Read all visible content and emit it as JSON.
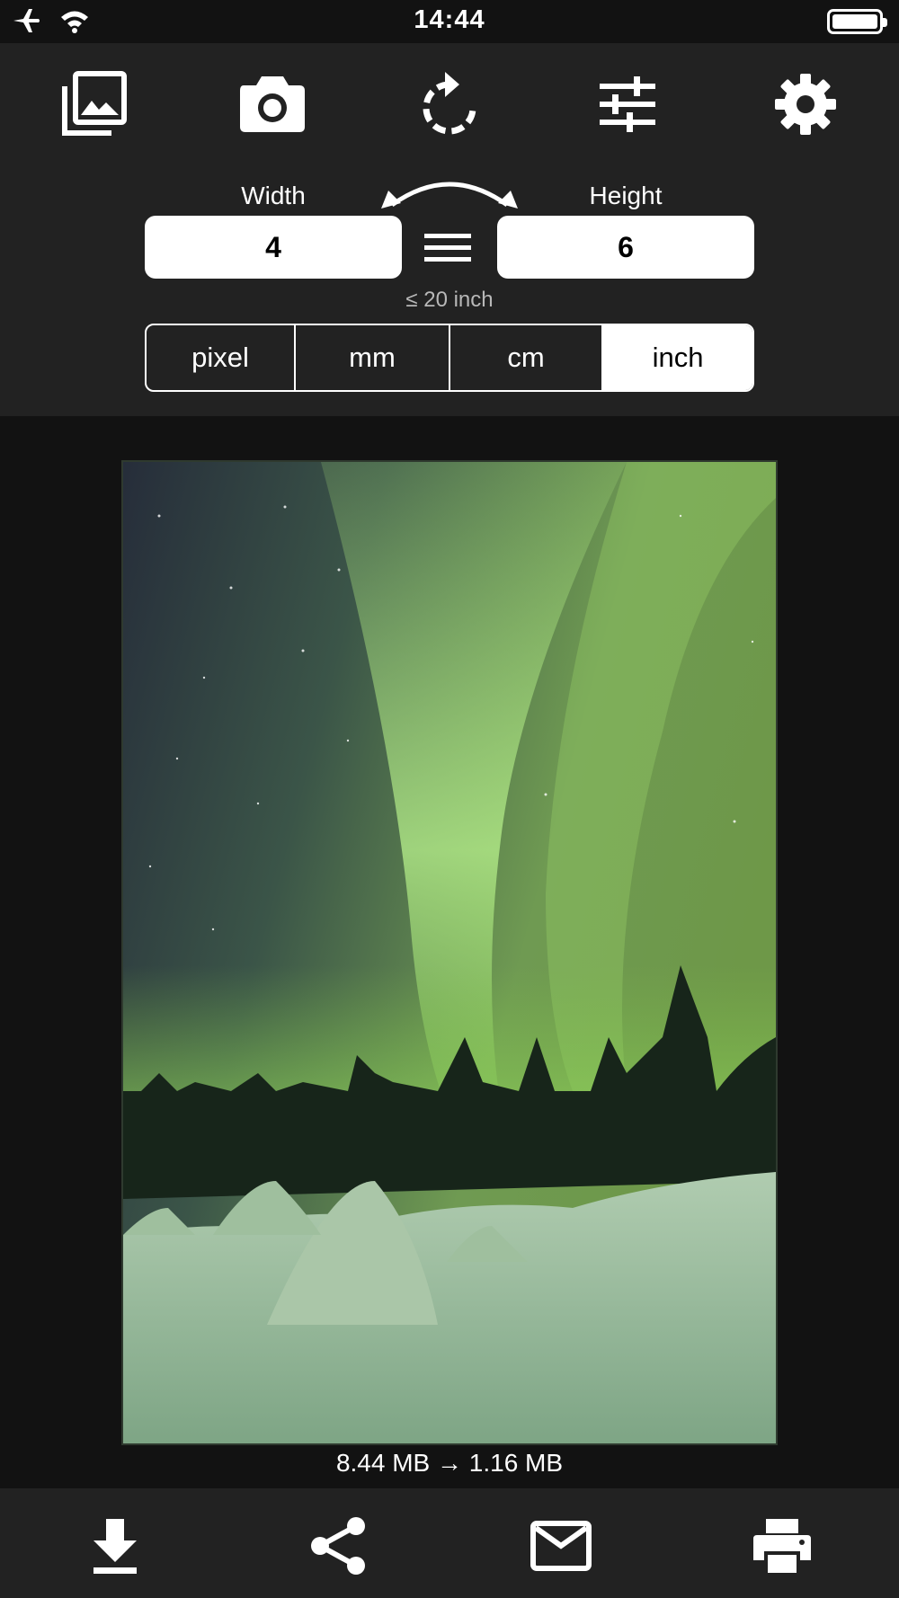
{
  "status": {
    "time": "14:44"
  },
  "toolbar": {
    "photos_icon": "photo-library-icon",
    "camera_icon": "camera-icon",
    "rotate_icon": "rotate-icon",
    "adjust_icon": "sliders-icon",
    "settings_icon": "gear-icon"
  },
  "dimensions": {
    "width_label": "Width",
    "width_value": "4",
    "height_label": "Height",
    "height_value": "6",
    "limit_text": "≤ 20 inch"
  },
  "units": {
    "options": [
      "pixel",
      "mm",
      "cm",
      "inch"
    ],
    "selected": "inch"
  },
  "file_size": {
    "text": "8.44 MB  →  1.16 MB"
  },
  "bottom_bar": {
    "save_icon": "download-icon",
    "share_icon": "share-icon",
    "mail_icon": "mail-icon",
    "print_icon": "print-icon"
  }
}
